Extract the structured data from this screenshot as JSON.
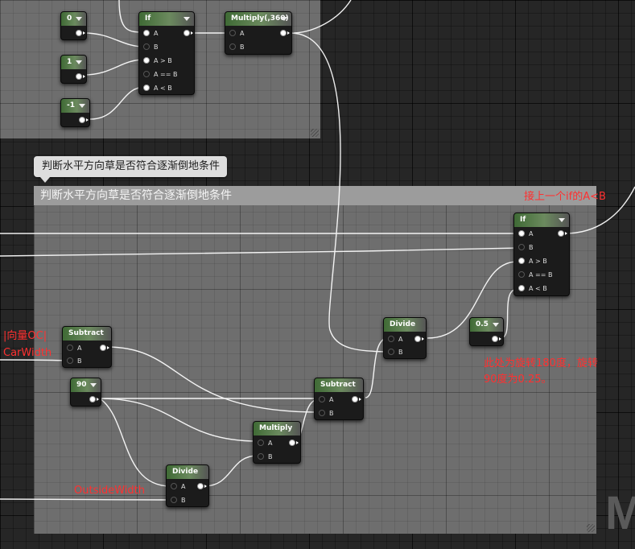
{
  "comments": {
    "top_box": {},
    "main_box": {
      "title": "判断水平方向草是否符合逐渐倒地条件"
    },
    "tooltip": {
      "text": "判断水平方向草是否符合逐渐倒地条件"
    }
  },
  "nodes": {
    "const_0": {
      "title": "0"
    },
    "const_1": {
      "title": "1"
    },
    "const_neg1": {
      "title": "-1"
    },
    "if_top": {
      "title": "If",
      "pins": [
        "A",
        "B",
        "A > B",
        "A == B",
        "A < B"
      ]
    },
    "multiply_360": {
      "title": "Multiply(,360)",
      "pins": [
        "A",
        "B"
      ]
    },
    "if_right": {
      "title": "If",
      "pins": [
        "A",
        "B",
        "A > B",
        "A == B",
        "A < B"
      ]
    },
    "subtract_left": {
      "title": "Subtract",
      "pins": [
        "A",
        "B"
      ]
    },
    "const_90": {
      "title": "90"
    },
    "divide_mid": {
      "title": "Divide",
      "pins": [
        "A",
        "B"
      ]
    },
    "const_0_5": {
      "title": "0.5"
    },
    "subtract_mid": {
      "title": "Subtract",
      "pins": [
        "A",
        "B"
      ]
    },
    "multiply": {
      "title": "Multiply",
      "pins": [
        "A",
        "B"
      ]
    },
    "divide_bottom": {
      "title": "Divide",
      "pins": [
        "A",
        "B"
      ]
    }
  },
  "annotations": {
    "top_right": "接上一个if的A<B",
    "left_line1": "|向量OC|",
    "left_line2": "CarWidth",
    "right_line1": "此处为旋转180度，旋转",
    "right_line2": "90度为0.25。",
    "outside_width": "OutsideWidth"
  },
  "watermark": "M",
  "colors": {
    "annotation": "#ff3030",
    "node_header": "#3f6a35",
    "wire": "#ffffff"
  }
}
